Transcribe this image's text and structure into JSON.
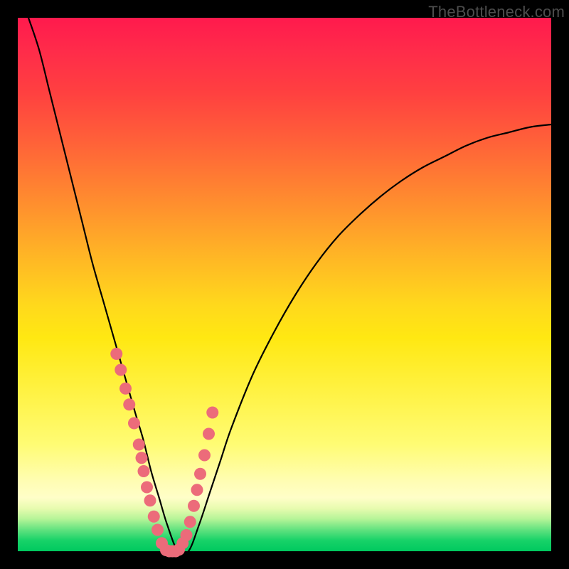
{
  "watermark": "TheBottleneck.com",
  "chart_data": {
    "type": "line",
    "title": "",
    "xlabel": "",
    "ylabel": "",
    "xlim": [
      0,
      100
    ],
    "ylim": [
      0,
      100
    ],
    "grid": false,
    "series": [
      {
        "name": "curve",
        "x": [
          2,
          4,
          6,
          8,
          10,
          12,
          14,
          16,
          18,
          20,
          22,
          23.5,
          25,
          26.5,
          28,
          30,
          32,
          34,
          36,
          38,
          40,
          44,
          48,
          52,
          56,
          60,
          64,
          68,
          72,
          76,
          80,
          84,
          88,
          92,
          96,
          100
        ],
        "y": [
          100,
          94,
          86,
          78,
          70,
          62,
          54,
          47,
          40,
          33,
          26,
          21,
          15,
          10,
          5,
          0,
          0,
          5,
          11,
          17,
          23,
          33,
          41,
          48,
          54,
          59,
          63,
          66.5,
          69.5,
          72,
          74,
          76,
          77.5,
          78.5,
          79.5,
          80
        ]
      }
    ],
    "points": {
      "name": "dots",
      "x": [
        18.5,
        19.3,
        20.2,
        20.9,
        21.8,
        22.7,
        23.2,
        23.6,
        24.2,
        24.8,
        25.5,
        26.2,
        27.0,
        27.8,
        28.4,
        29.0,
        29.6,
        30.2,
        30.9,
        31.6,
        32.3,
        33.0,
        33.6,
        34.2,
        35.0,
        35.8,
        36.5
      ],
      "y": [
        37.0,
        34.0,
        30.5,
        27.5,
        24.0,
        20.0,
        17.5,
        15.0,
        12.0,
        9.5,
        6.5,
        4.0,
        1.5,
        0.2,
        0.0,
        0.0,
        0.0,
        0.3,
        1.5,
        3.0,
        5.5,
        8.5,
        11.5,
        14.5,
        18.0,
        22.0,
        26.0
      ]
    },
    "colors": {
      "curve": "#000000",
      "dots": "#ec6b7a"
    }
  }
}
